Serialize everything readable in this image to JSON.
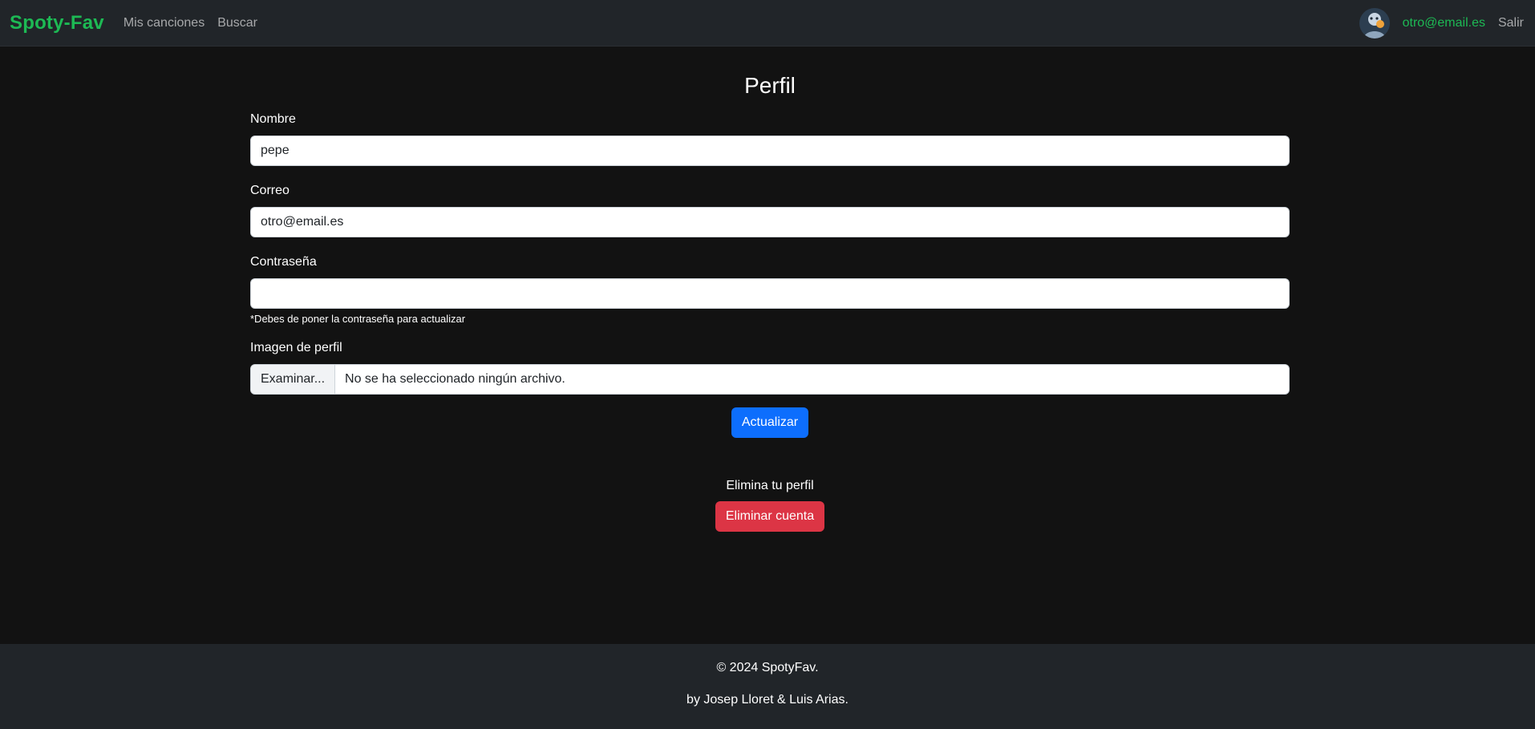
{
  "navbar": {
    "brand": "Spoty-Fav",
    "links": [
      {
        "label": "Mis canciones"
      },
      {
        "label": "Buscar"
      }
    ],
    "user_email": "otro@email.es",
    "logout_label": "Salir",
    "avatar_icon": "user-avatar-icon"
  },
  "profile": {
    "title": "Perfil",
    "name_label": "Nombre",
    "name_value": "pepe",
    "email_label": "Correo",
    "email_value": "otro@email.es",
    "password_label": "Contraseña",
    "password_value": "",
    "password_hint": "*Debes de poner la contraseña para actualizar",
    "image_label": "Imagen de perfil",
    "file_button_label": "Examinar...",
    "file_status": "No se ha seleccionado ningún archivo.",
    "update_button": "Actualizar"
  },
  "delete": {
    "text": "Elimina tu perfil",
    "button": "Eliminar cuenta"
  },
  "footer": {
    "copyright": "© 2024 SpotyFav.",
    "authors": "by Josep Lloret & Luis Arias."
  },
  "colors": {
    "brand": "#1db954",
    "background": "#121212",
    "navbar": "#212529",
    "primary": "#0d6efd",
    "danger": "#dc3545"
  }
}
